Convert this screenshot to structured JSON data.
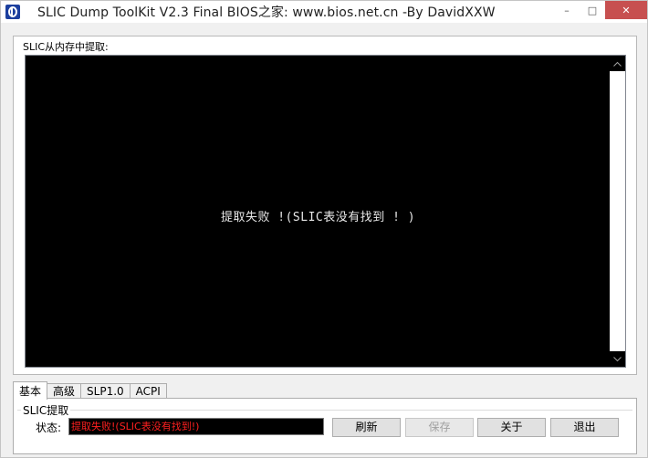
{
  "window": {
    "title": "SLIC Dump ToolKit V2.3 Final     BIOS之家: www.bios.net.cn  -By DavidXXW",
    "minimize_glyph": "–",
    "maximize_glyph": "□",
    "close_glyph": "✕",
    "icon": "app-logo-icon"
  },
  "main_group": {
    "label": "SLIC从内存中提取:",
    "console_message": "提取失败 !(SLIC表没有找到 ! )"
  },
  "tabs": [
    {
      "label": "基本",
      "active": true
    },
    {
      "label": "高级",
      "active": false
    },
    {
      "label": "SLP1.0",
      "active": false
    },
    {
      "label": "ACPI",
      "active": false
    }
  ],
  "panel": {
    "group_label": "SLIC提取",
    "status_label": "状态:",
    "status_value": "提取失败!(SLIC表没有找到!)",
    "buttons": {
      "refresh": "刷新",
      "save": "保存",
      "about": "关于",
      "exit": "退出"
    }
  },
  "colors": {
    "console_bg": "#000000",
    "console_text": "#e8e8e8",
    "status_text": "#ff2020",
    "close_button": "#c75050",
    "icon_bg": "#1c3f9e"
  }
}
